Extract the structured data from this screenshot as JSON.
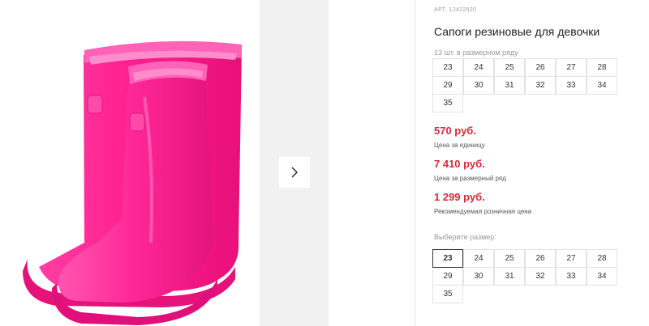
{
  "product": {
    "article_label": "АРТ.",
    "article_number": "12422520",
    "title": "Сапоги резиновые для девочки",
    "size_row_note": "13 шт. в размерном ряду",
    "sizes": [
      "23",
      "24",
      "25",
      "26",
      "27",
      "28",
      "29",
      "30",
      "31",
      "32",
      "33",
      "34",
      "35"
    ]
  },
  "prices": {
    "unit_price": "570 руб.",
    "unit_price_label": "Цена за единицу",
    "row_price": "7 410 руб.",
    "row_price_label": "Цена за размерный ряд",
    "retail_price": "1 299 руб.",
    "retail_price_label": "Рекомендуемая розничная цена"
  },
  "size_selector": {
    "label": "Выберите размер:",
    "selected": "23"
  },
  "gallery": {
    "image_icon": "pink-rubber-boots",
    "next_icon": "chevron-right-icon"
  },
  "colors": {
    "price_red": "#d42b3a",
    "boot_pink": "#ff1f8f"
  }
}
